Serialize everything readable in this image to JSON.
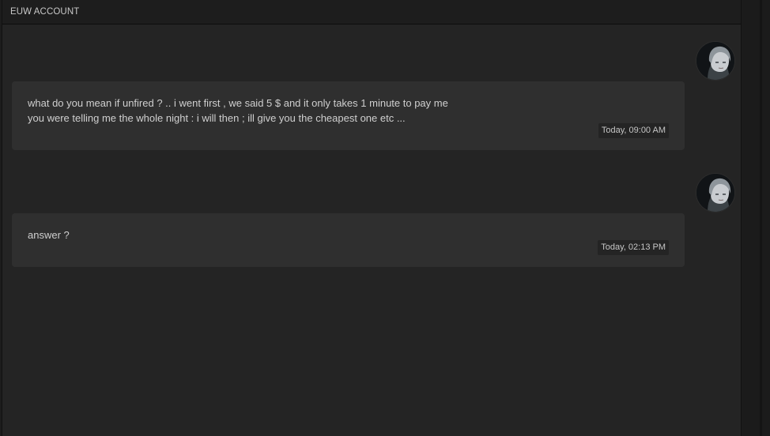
{
  "header": {
    "title": "EUW ACCOUNT"
  },
  "messages": [
    {
      "text": "what do you mean if unfired ? .. i went first , we said 5 $ and it only takes 1 minute to pay me\nyou were telling me the whole night : i will then ; ill give you the cheapest one etc ...",
      "timestamp": "Today, 09:00 AM",
      "avatar_icon": "user-avatar-icon"
    },
    {
      "text": "answer ?",
      "timestamp": "Today, 02:13 PM",
      "avatar_icon": "user-avatar-icon"
    }
  ],
  "colors": {
    "panel_bg": "#242424",
    "bubble_bg": "#2f2f2f",
    "text": "#cfcfcf",
    "timestamp_bg": "#242424"
  }
}
